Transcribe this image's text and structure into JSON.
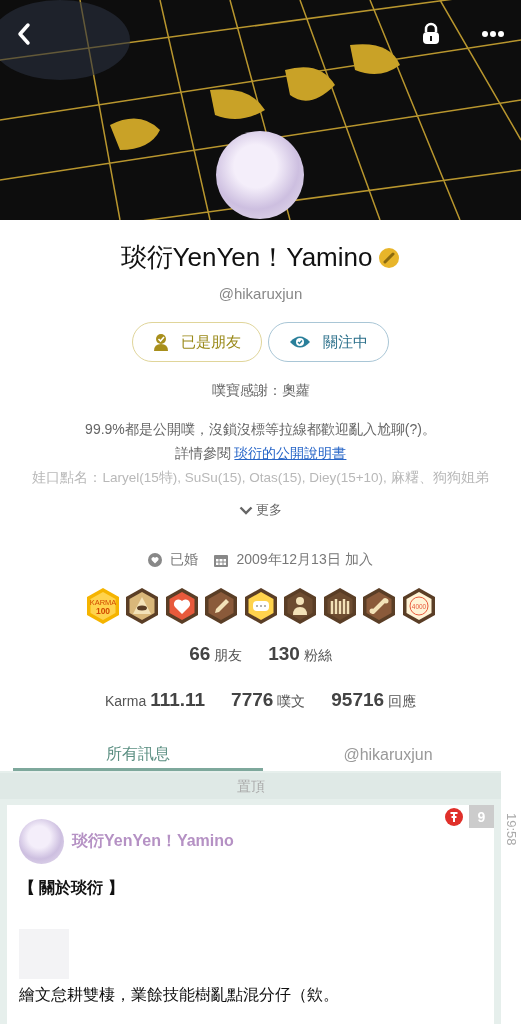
{
  "profile": {
    "display_name": "琰衍YenYen！Yamino",
    "handle": "@hikaruxjun",
    "buttons": [
      {
        "label": "已是朋友",
        "kind": "friend"
      },
      {
        "label": "關注中",
        "kind": "follow"
      }
    ],
    "thanks": "噗寶感謝：奧蘿",
    "bio": [
      {
        "text": "99.9%都是公開噗，沒鎖沒標等拉線都歡迎亂入尬聊(?)。",
        "faded": false
      },
      {
        "text": "詳情參閱",
        "link": "琰衍的公開說明書",
        "faded": false
      },
      {
        "text": "娃口點名：Laryel(15特), SuSu(15), Otas(15), Diey(15+10), 麻糬、狗狗姐弟",
        "faded": true
      }
    ],
    "more": "更多",
    "relationship": "已婚",
    "joined": "2009年12月13日 加入",
    "badges": [
      {
        "kind": "karma",
        "text": "KARMA 100"
      },
      {
        "kind": "eye"
      },
      {
        "kind": "heart"
      },
      {
        "kind": "pencil"
      },
      {
        "kind": "chat"
      },
      {
        "kind": "person"
      },
      {
        "kind": "crowd"
      },
      {
        "kind": "bone"
      },
      {
        "kind": "count",
        "text": "4000"
      }
    ],
    "social": [
      "**66** 朋友",
      "**130** 粉絲"
    ],
    "activity": [
      "Karma **111.11**",
      "**7776** 噗文",
      "**95716** 回應"
    ]
  },
  "tabs": [
    {
      "label": "所有訊息",
      "selected": true
    },
    {
      "label": "@hikaruxjun",
      "selected": false
    }
  ],
  "pinned_header": "置頂",
  "post": {
    "author": "琰衍YenYen！Yamino",
    "pinned": true,
    "response_count": "9",
    "time": "19:58",
    "title": "【 關於琰衍 】",
    "body": "繪文怠耕雙棲，業餘技能樹亂點混分仔（欸。"
  }
}
